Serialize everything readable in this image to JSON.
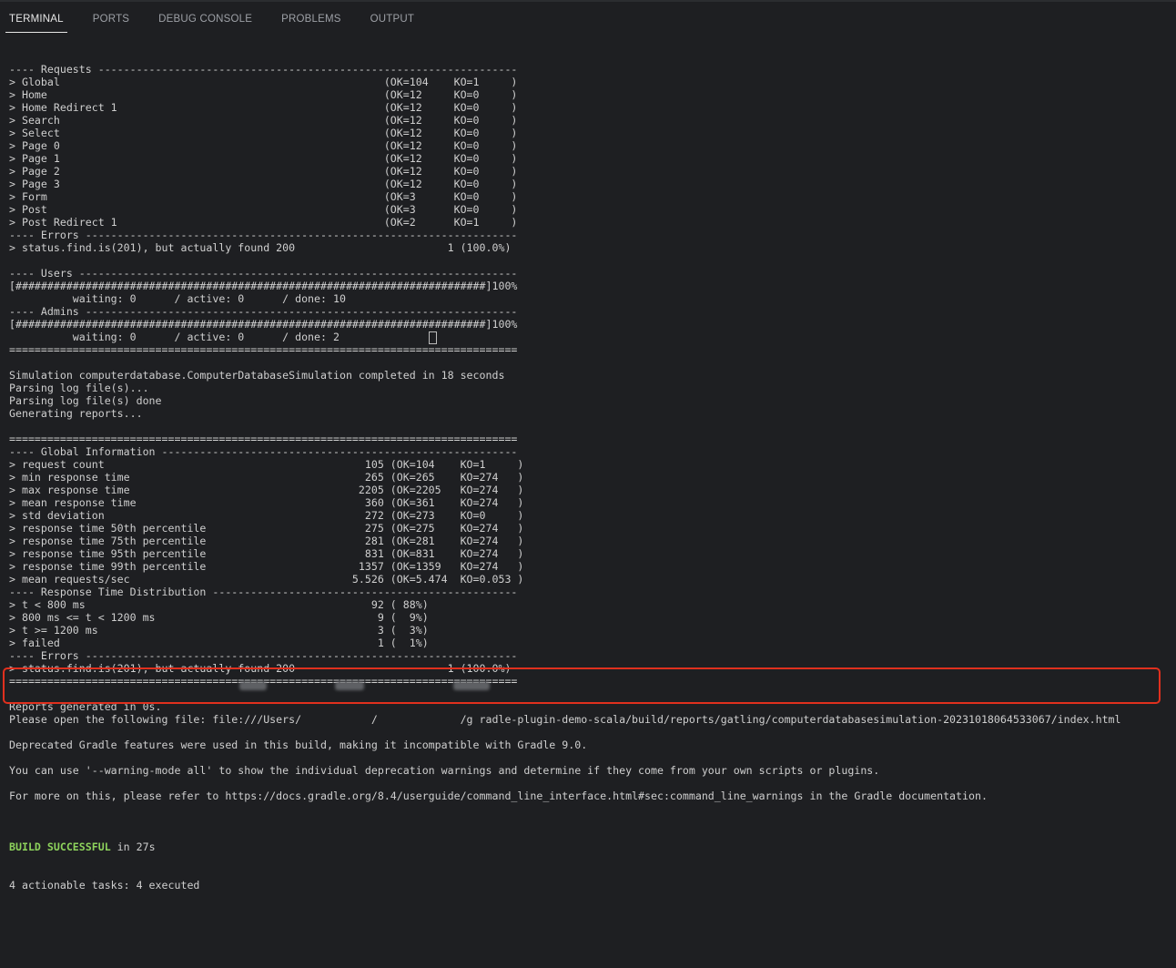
{
  "tabs": [
    {
      "label": "TERMINAL",
      "active": true
    },
    {
      "label": "PORTS",
      "active": false
    },
    {
      "label": "DEBUG CONSOLE",
      "active": false
    },
    {
      "label": "PROBLEMS",
      "active": false
    },
    {
      "label": "OUTPUT",
      "active": false
    }
  ],
  "terminal": {
    "lines": [
      "---- Requests ------------------------------------------------------------------",
      "> Global                                                   (OK=104    KO=1     )",
      "> Home                                                     (OK=12     KO=0     )",
      "> Home Redirect 1                                          (OK=12     KO=0     )",
      "> Search                                                   (OK=12     KO=0     )",
      "> Select                                                   (OK=12     KO=0     )",
      "> Page 0                                                   (OK=12     KO=0     )",
      "> Page 1                                                   (OK=12     KO=0     )",
      "> Page 2                                                   (OK=12     KO=0     )",
      "> Page 3                                                   (OK=12     KO=0     )",
      "> Form                                                     (OK=3      KO=0     )",
      "> Post                                                     (OK=3      KO=0     )",
      "> Post Redirect 1                                          (OK=2      KO=1     )",
      "---- Errors --------------------------------------------------------------------",
      "> status.find.is(201), but actually found 200                        1 (100.0%)",
      "",
      "---- Users ---------------------------------------------------------------------",
      "[##########################################################################]100%",
      "          waiting: 0      / active: 0      / done: 10",
      "---- Admins --------------------------------------------------------------------",
      "[##########################################################################]100%",
      "          waiting: 0      / active: 0      / done: 2",
      "================================================================================",
      "",
      "Simulation computerdatabase.ComputerDatabaseSimulation completed in 18 seconds",
      "Parsing log file(s)...",
      "Parsing log file(s) done",
      "Generating reports...",
      "",
      "================================================================================",
      "---- Global Information --------------------------------------------------------",
      "> request count                                         105 (OK=104    KO=1     )",
      "> min response time                                     265 (OK=265    KO=274   )",
      "> max response time                                    2205 (OK=2205   KO=274   )",
      "> mean response time                                    360 (OK=361    KO=274   )",
      "> std deviation                                         272 (OK=273    KO=0     )",
      "> response time 50th percentile                         275 (OK=275    KO=274   )",
      "> response time 75th percentile                         281 (OK=281    KO=274   )",
      "> response time 95th percentile                         831 (OK=831    KO=274   )",
      "> response time 99th percentile                        1357 (OK=1359   KO=274   )",
      "> mean requests/sec                                   5.526 (OK=5.474  KO=0.053 )",
      "---- Response Time Distribution ------------------------------------------------",
      "> t < 800 ms                                             92 ( 88%)",
      "> 800 ms <= t < 1200 ms                                   9 (  9%)",
      "> t >= 1200 ms                                            3 (  3%)",
      "> failed                                                  1 (  1%)",
      "---- Errors --------------------------------------------------------------------",
      "> status.find.is(201), but actually found 200                        1 (100.0%)",
      "================================================================================",
      "",
      "Reports generated in 0s.",
      "Please open the following file: file:///Users/           /             /g radle-plugin-demo-scala/build/reports/gatling/computerdatabasesimulation-20231018064533067/index.html",
      "",
      "Deprecated Gradle features were used in this build, making it incompatible with Gradle 9.0.",
      "",
      "You can use '--warning-mode all' to show the individual deprecation warnings and determine if they come from your own scripts or plugins.",
      "",
      "For more on this, please refer to https://docs.gradle.org/8.4/userguide/command_line_interface.html#sec:command_line_warnings in the Gradle documentation.",
      ""
    ],
    "build_status": "BUILD SUCCESSFUL",
    "build_time": " in 27s",
    "tasks_line": "4 actionable tasks: 4 executed"
  }
}
